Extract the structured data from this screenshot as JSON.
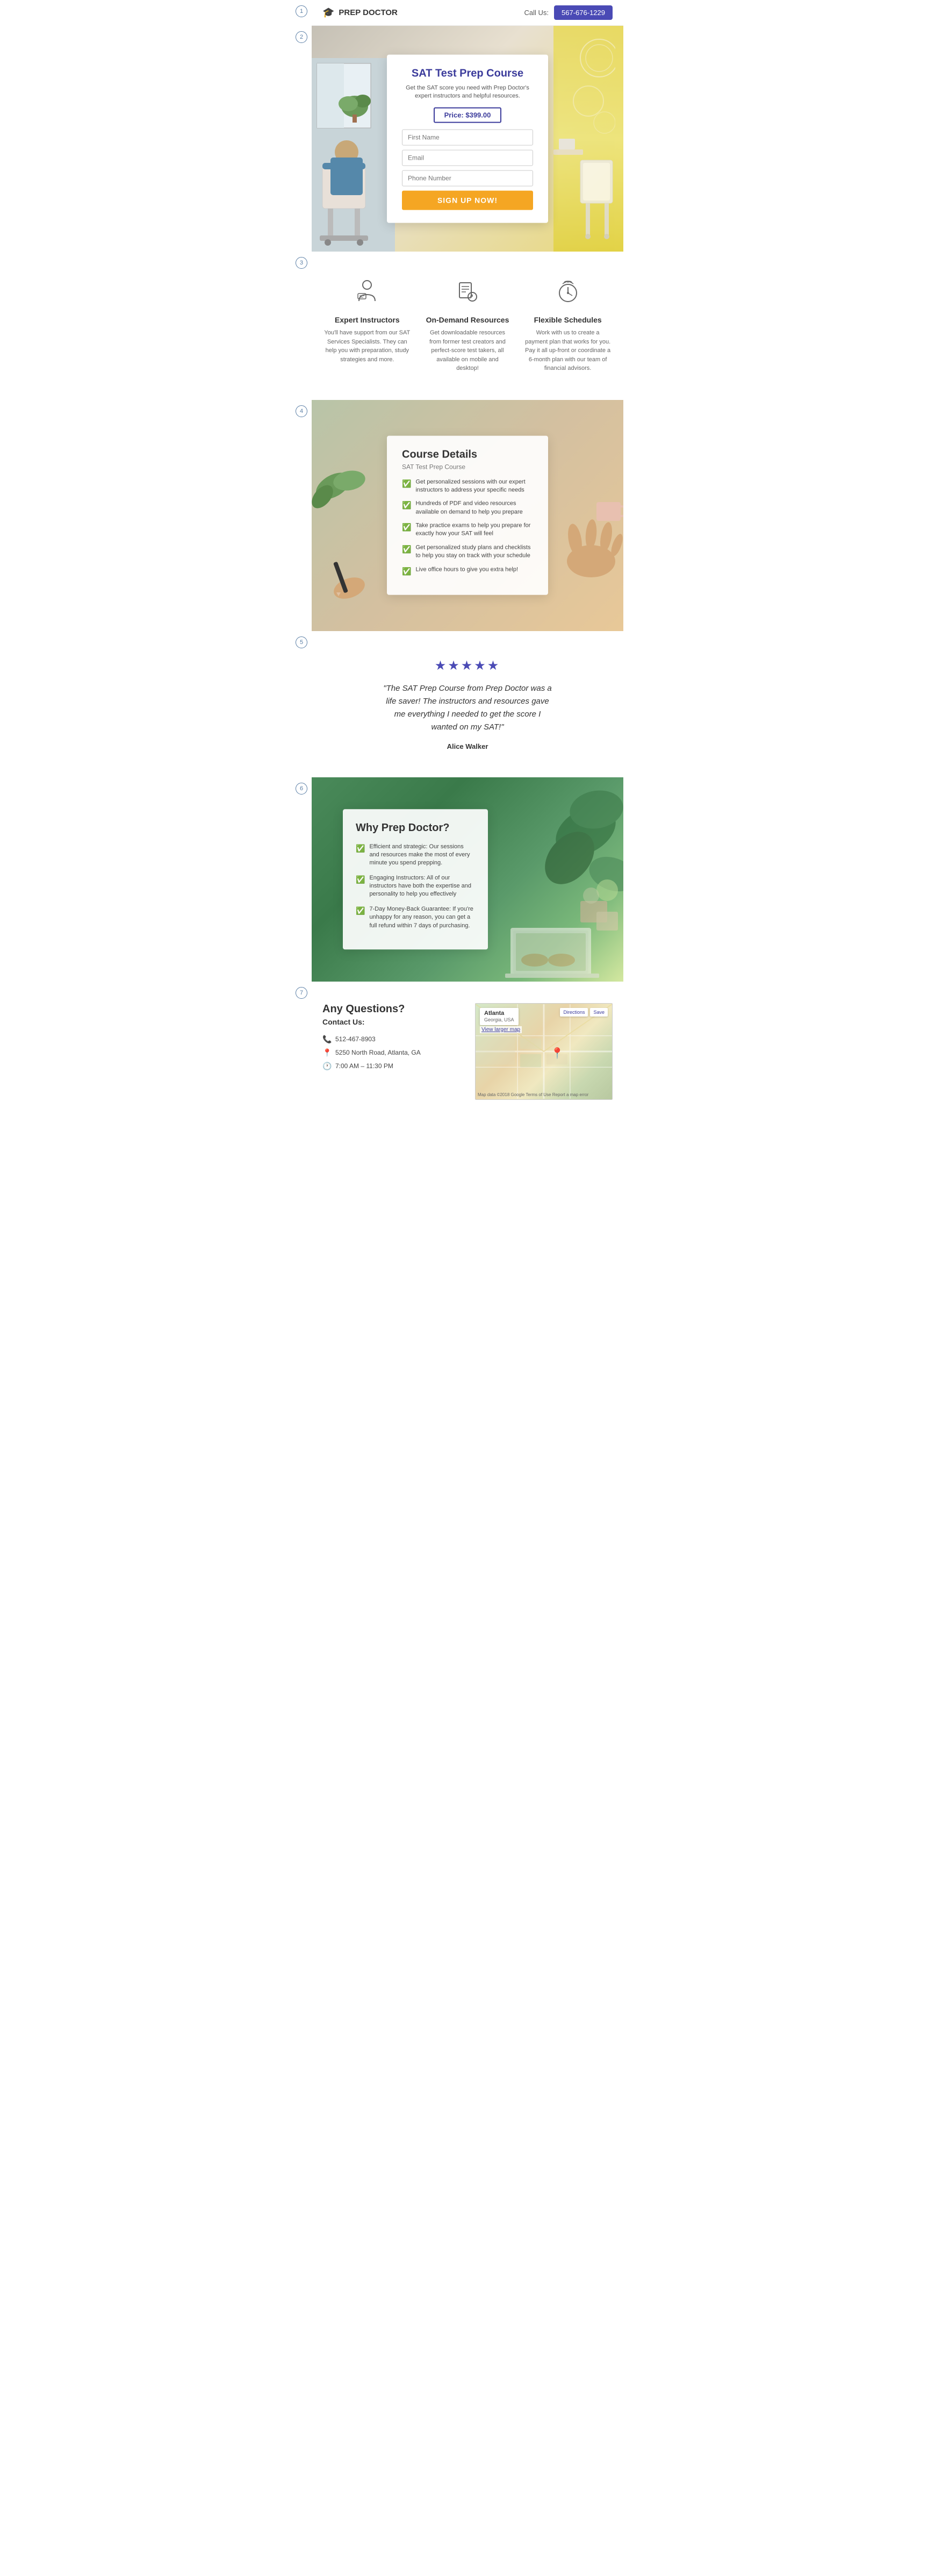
{
  "header": {
    "logo_text": "PREP DOCTOR",
    "call_label": "Call Us:",
    "phone": "567-676-1229"
  },
  "hero": {
    "title": "SAT Test Prep Course",
    "subtitle": "Get the SAT score you need with Prep Doctor's expert instructors and helpful resources.",
    "price_label": "Price: $399.00",
    "form": {
      "first_name_placeholder": "First Name",
      "email_placeholder": "Email",
      "phone_placeholder": "Phone Number"
    },
    "signup_label": "SIGN UP NOW!"
  },
  "features": {
    "items": [
      {
        "icon": "👤",
        "title": "Expert Instructors",
        "text": "You'll have support from our SAT Services Specialists. They can help you with preparation, study strategies and more."
      },
      {
        "icon": "📋",
        "title": "On-Demand Resources",
        "text": "Get downloadable resources from former test creators and perfect-score test takers, all available on mobile and desktop!"
      },
      {
        "icon": "⏰",
        "title": "Flexible Schedules",
        "text": "Work with us to create a payment plan that works for you. Pay it all up-front or coordinate a 6-month plan with our team of financial advisors."
      }
    ]
  },
  "course": {
    "title": "Course Details",
    "subtitle": "SAT Test Prep Course",
    "items": [
      "Get personalized sessions with our expert instructors to address your specific needs",
      "Hundreds of PDF and video resources available on demand to help you prepare",
      "Take practice exams to help you prepare for exactly how your SAT will feel",
      "Get personalized study plans and checklists to help you stay on track with your schedule",
      "Live office hours to give you extra help!"
    ]
  },
  "testimonial": {
    "stars": "★★★★★",
    "quote": "\"The SAT Prep Course from Prep Doctor was a life saver! The instructors and resources gave me everything I needed to get the score I wanted on my SAT!\"",
    "author": "Alice Walker"
  },
  "why": {
    "title": "Why Prep Doctor?",
    "items": [
      "Efficient and strategic: Our sessions and resources make the most of every minute you spend prepping.",
      "Engaging Instructors: All of our instructors have both the expertise and personality to help you effectively",
      "7-Day Money-Back Guarantee: If you're unhappy for any reason, you can get a full refund within 7 days of purchasing."
    ]
  },
  "contact": {
    "title": "Any Questions?",
    "subtitle": "Contact Us:",
    "phone": "512-467-8903",
    "address": "5250 North Road, Atlanta, GA",
    "hours": "7:00 AM – 11:30 PM",
    "map": {
      "city": "Atlanta",
      "region": "Georgia, USA",
      "directions_label": "Directions",
      "save_label": "Save",
      "view_larger": "View larger map",
      "footer": "Map data ©2018 Google  Terms of Use  Report a map error"
    }
  },
  "section_numbers": [
    "1",
    "2",
    "3",
    "4",
    "5",
    "6",
    "7"
  ]
}
